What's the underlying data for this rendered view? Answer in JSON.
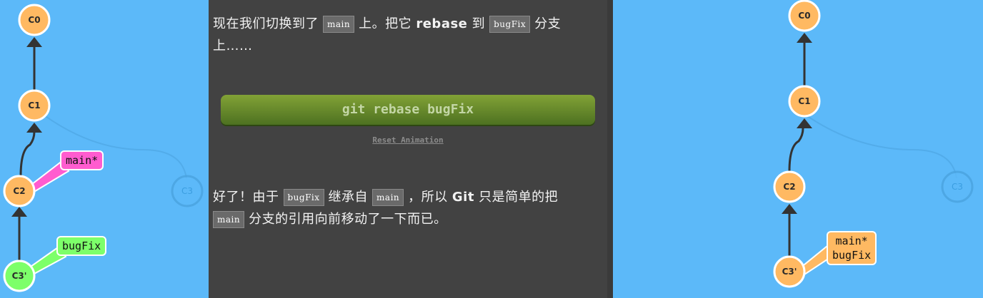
{
  "left_graph": {
    "nodes": {
      "c0": "C0",
      "c1": "C1",
      "c2": "C2",
      "c3": "C3",
      "c3p": "C3'"
    },
    "branches": {
      "main": "main*",
      "bugfix": "bugFix"
    },
    "colors": {
      "node": "#ffb962",
      "node_new": "#7dff6a",
      "main_tag": "#ff5ccf",
      "bugfix_tag": "#7dff6a"
    }
  },
  "center": {
    "para1": {
      "t1": "现在我们切换到了",
      "code1": "main",
      "t2": "上。把它",
      "bold1": "rebase",
      "t3": "到",
      "code2": "bugFix",
      "t4": "分支上……"
    },
    "command_button": "git rebase bugFix",
    "reset_link": "Reset Animation",
    "para2": {
      "t1": "好了！由于",
      "code1": "bugFix",
      "t2": "继承自",
      "code2": "main",
      "t3": "，所以",
      "bold1": "Git",
      "t4": "只是简单的把",
      "code3": "main",
      "t5": "分支的引用向前移动了一下而已。"
    },
    "colors": {
      "panel_bg": "#424242",
      "button_top": "#82a236",
      "button_bottom": "#4d7121"
    }
  },
  "right_graph": {
    "nodes": {
      "c0": "C0",
      "c1": "C1",
      "c2": "C2",
      "c3": "C3",
      "c3p": "C3'"
    },
    "branches": {
      "main": "main*",
      "bugfix": "bugFix"
    },
    "colors": {
      "node": "#ffb962",
      "tag": "#ffb962"
    }
  },
  "background": "#5cb9f9"
}
